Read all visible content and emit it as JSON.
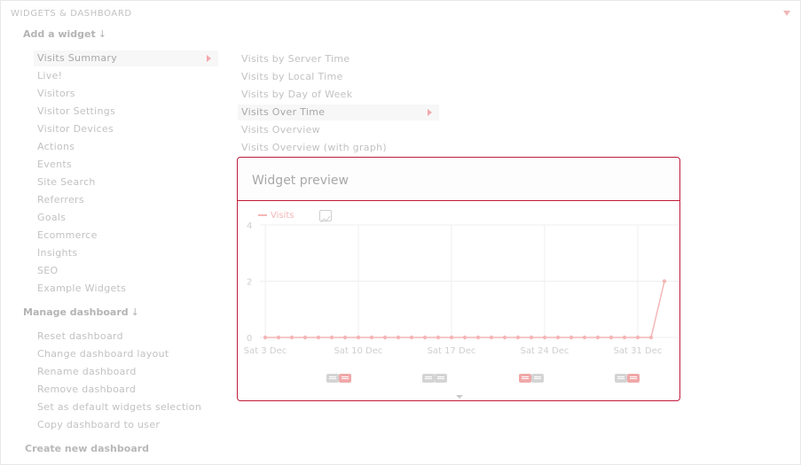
{
  "header": {
    "title": "WIDGETS & DASHBOARD"
  },
  "add_widget": {
    "heading": "Add a widget",
    "arrow": "↓",
    "categories": [
      "Visits Summary",
      "Live!",
      "Visitors",
      "Visitor Settings",
      "Visitor Devices",
      "Actions",
      "Events",
      "Site Search",
      "Referrers",
      "Goals",
      "Ecommerce",
      "Insights",
      "SEO",
      "Example Widgets"
    ],
    "active_category": "Visits Summary",
    "widgets": [
      "Visits by Server Time",
      "Visits by Local Time",
      "Visits by Day of Week",
      "Visits Over Time",
      "Visits Overview",
      "Visits Overview (with graph)"
    ],
    "active_widget": "Visits Over Time"
  },
  "manage": {
    "heading": "Manage dashboard",
    "arrow": "↓",
    "items": [
      "Reset dashboard",
      "Change dashboard layout",
      "Rename dashboard",
      "Remove dashboard",
      "Set as default widgets selection",
      "Copy dashboard to user"
    ]
  },
  "create": {
    "label": "Create new dashboard"
  },
  "preview": {
    "title": "Widget preview"
  },
  "colors": {
    "accent": "#c01a3a",
    "series": "#f4b6b6",
    "grid": "#efefef"
  },
  "chart_data": {
    "type": "line",
    "series": [
      {
        "name": "Visits",
        "values": [
          0,
          0,
          0,
          0,
          0,
          0,
          0,
          0,
          0,
          0,
          0,
          0,
          0,
          0,
          0,
          0,
          0,
          0,
          0,
          0,
          0,
          0,
          0,
          0,
          0,
          0,
          0,
          0,
          0,
          0,
          2
        ]
      }
    ],
    "x_tick_labels": [
      "Sat 3 Dec",
      "Sat 10 Dec",
      "Sat 17 Dec",
      "Sat 24 Dec",
      "Sat 31 Dec"
    ],
    "y_ticks": [
      0,
      2,
      4
    ],
    "ylim": [
      0,
      4
    ],
    "grid": true,
    "legend_position": "top-left"
  },
  "annotations": {
    "icon": "annotation-icon",
    "groups": [
      {
        "first": "grey",
        "second": "red"
      },
      {
        "first": "grey",
        "second": "grey"
      },
      {
        "first": "red",
        "second": "grey"
      },
      {
        "first": "grey",
        "second": "red"
      }
    ]
  }
}
